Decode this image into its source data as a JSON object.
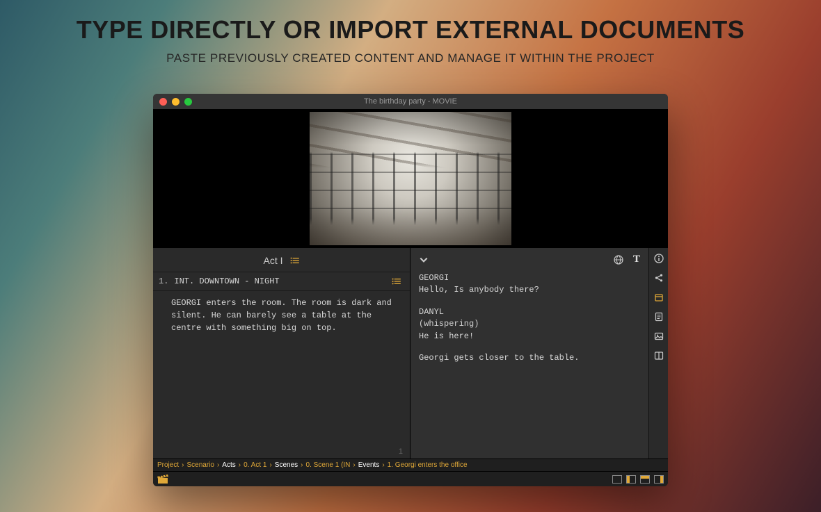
{
  "hero": {
    "title": "TYPE DIRECTLY OR IMPORT EXTERNAL DOCUMENTS",
    "subtitle": "PASTE PREVIOUSLY CREATED CONTENT AND MANAGE IT WITHIN THE PROJECT"
  },
  "window": {
    "title": "The birthday party - MOVIE"
  },
  "left": {
    "act_label": "Act I",
    "scene": {
      "number": "1.",
      "heading": "INT.  DOWNTOWN - NIGHT"
    },
    "scene_description": "GEORGI enters the room. The room is dark and silent. He can barely see a table at the centre with something big on top.",
    "page_number": "1"
  },
  "right": {
    "dialogue": [
      {
        "character": "GEORGI",
        "paren": "",
        "line": "Hello, Is anybody there?"
      },
      {
        "character": "DANYL",
        "paren": "(whispering)",
        "line": "He is here!"
      }
    ],
    "action": "Georgi gets closer to the table."
  },
  "breadcrumb": [
    {
      "label": "Project",
      "bold": false
    },
    {
      "label": "Scenario",
      "bold": false
    },
    {
      "label": "Acts",
      "bold": true
    },
    {
      "label": "0. Act 1",
      "bold": false
    },
    {
      "label": "Scenes",
      "bold": true
    },
    {
      "label": "0. Scene 1 (IN",
      "bold": false
    },
    {
      "label": "Events",
      "bold": true
    },
    {
      "label": "1. Georgi enters the office",
      "bold": false
    }
  ],
  "right_toolbar_icons": [
    "info-icon",
    "share-icon",
    "project-icon",
    "notes-icon",
    "image-icon",
    "layout-icon"
  ],
  "bottom_layouts": [
    "layout-1",
    "layout-2",
    "layout-3",
    "layout-4"
  ]
}
